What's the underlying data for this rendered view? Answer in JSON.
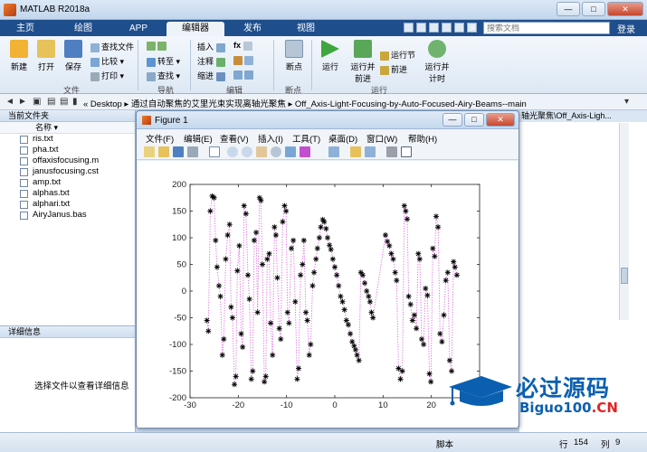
{
  "window": {
    "title": "MATLAB R2018a",
    "controls": [
      "—",
      "□",
      "✕"
    ]
  },
  "tabs": [
    "主页",
    "绘图",
    "APP",
    "编辑器",
    "发布",
    "视图"
  ],
  "active_tab": "编辑器",
  "search": {
    "placeholder": "搜索文档"
  },
  "login_label": "登录",
  "ribbon": {
    "file_group": {
      "label": "文件",
      "new": "新建",
      "open": "打开",
      "save": "保存",
      "find_files": "查找文件",
      "compare": "比较",
      "print": "打印"
    },
    "nav_group": {
      "label": "导航",
      "goto": "转至",
      "find": "查找"
    },
    "edit_group": {
      "label": "编辑",
      "insert": "插入",
      "comment": "注释",
      "indent": "缩进",
      "fx": "fx"
    },
    "break_group": {
      "label": "断点",
      "breakpoints": "断点"
    },
    "run_group": {
      "label": "运行",
      "run": "运行",
      "run_advance": "运行并前进",
      "run_section": "运行节",
      "advance": "前进",
      "run_time": "运行并计时"
    }
  },
  "address": {
    "path": "« Desktop ▸ 通过自动聚焦的艾里光束实现离轴光聚焦 ▸ Off_Axis-Light-Focusing-by-Auto-Focused-Airy-Beams--main"
  },
  "folder_panel": {
    "title": "当前文件夹",
    "column": "名称 ▾",
    "files": [
      "ris.txt",
      "pha.txt",
      "offaxisfocusing.m",
      "janusfocusing.cst",
      "amp.txt",
      "alphas.txt",
      "alphari.txt",
      "AiryJanus.bas"
    ]
  },
  "details_panel": {
    "title": "详细信息",
    "message": "选择文件以查看详细信息"
  },
  "background_panel": {
    "header": "轴光聚焦\\Off_Axis-Ligh..."
  },
  "status": {
    "mode": "脚本",
    "row_label": "行",
    "row": "154",
    "col_label": "列",
    "col": "9"
  },
  "figure": {
    "title": "Figure 1",
    "menu": [
      "文件(F)",
      "编辑(E)",
      "查看(V)",
      "插入(I)",
      "工具(T)",
      "桌面(D)",
      "窗口(W)",
      "帮助(H)"
    ],
    "controls": [
      "—",
      "□",
      "✕"
    ]
  },
  "chart_data": {
    "type": "scatter",
    "title": "",
    "xlabel": "",
    "ylabel": "",
    "xlim": [
      -30,
      30
    ],
    "ylim": [
      -200,
      200
    ],
    "xticks": [
      -30,
      -20,
      -10,
      0,
      10,
      20
    ],
    "yticks": [
      -200,
      -150,
      -100,
      -50,
      0,
      50,
      100,
      150,
      200
    ],
    "series": [
      {
        "marker": "*",
        "color": "#000000",
        "line_style": "dotted",
        "line_color": "#e060e0",
        "points": [
          [
            -26.5,
            -55
          ],
          [
            -26.2,
            -75
          ],
          [
            -25.8,
            150
          ],
          [
            -25.4,
            178
          ],
          [
            -25,
            175
          ],
          [
            -24.7,
            95
          ],
          [
            -24.4,
            45
          ],
          [
            -24,
            10
          ],
          [
            -23.7,
            -10
          ],
          [
            -23.3,
            -120
          ],
          [
            -23,
            -90
          ],
          [
            -22.6,
            60
          ],
          [
            -22.2,
            105
          ],
          [
            -21.8,
            125
          ],
          [
            -21.5,
            -30
          ],
          [
            -21.2,
            -50
          ],
          [
            -20.8,
            -175
          ],
          [
            -20.5,
            -160
          ],
          [
            -20.2,
            38
          ],
          [
            -19.8,
            85
          ],
          [
            -19.4,
            -80
          ],
          [
            -19.1,
            -105
          ],
          [
            -18.8,
            160
          ],
          [
            -18.4,
            145
          ],
          [
            -18,
            30
          ],
          [
            -17.7,
            -15
          ],
          [
            -17.3,
            -165
          ],
          [
            -17,
            -150
          ],
          [
            -16.7,
            95
          ],
          [
            -16.3,
            110
          ],
          [
            -16,
            -40
          ],
          [
            -15.6,
            175
          ],
          [
            -15.3,
            170
          ],
          [
            -15,
            50
          ],
          [
            -14.6,
            -170
          ],
          [
            -14.3,
            -160
          ],
          [
            -14,
            60
          ],
          [
            -13.6,
            70
          ],
          [
            -13.3,
            -60
          ],
          [
            -12.9,
            -120
          ],
          [
            -12.5,
            120
          ],
          [
            -12.2,
            105
          ],
          [
            -11.9,
            25
          ],
          [
            -11.5,
            -70
          ],
          [
            -11.2,
            -90
          ],
          [
            -10.8,
            130
          ],
          [
            -10.4,
            160
          ],
          [
            -10.1,
            150
          ],
          [
            -9.8,
            -40
          ],
          [
            -9.5,
            -60
          ],
          [
            -9,
            80
          ],
          [
            -8.6,
            95
          ],
          [
            -8.2,
            -20
          ],
          [
            -7.8,
            -165
          ],
          [
            -7.5,
            -145
          ],
          [
            -7.1,
            30
          ],
          [
            -6.7,
            50
          ],
          [
            -6.4,
            95
          ],
          [
            -6,
            -40
          ],
          [
            -5.7,
            -55
          ],
          [
            -5.3,
            -120
          ],
          [
            -5,
            -100
          ],
          [
            -4.6,
            10
          ],
          [
            -4.3,
            35
          ],
          [
            -3.9,
            60
          ],
          [
            -3.6,
            80
          ],
          [
            -3.2,
            100
          ],
          [
            -2.9,
            120
          ],
          [
            -2.5,
            134
          ],
          [
            -2.2,
            130
          ],
          [
            -1.8,
            117
          ],
          [
            -1.5,
            100
          ],
          [
            -1.1,
            86
          ],
          [
            -0.8,
            78
          ],
          [
            -0.4,
            60
          ],
          [
            0,
            45
          ],
          [
            0.4,
            30
          ],
          [
            0.8,
            10
          ],
          [
            1.2,
            -10
          ],
          [
            1.6,
            -20
          ],
          [
            2,
            -35
          ],
          [
            2.4,
            -55
          ],
          [
            2.8,
            -63
          ],
          [
            3.2,
            -80
          ],
          [
            3.6,
            -95
          ],
          [
            4,
            -103
          ],
          [
            4.3,
            -110
          ],
          [
            4.6,
            -120
          ],
          [
            5,
            -130
          ],
          [
            5.4,
            35
          ],
          [
            5.8,
            30
          ],
          [
            6.2,
            15
          ],
          [
            6.6,
            0
          ],
          [
            7,
            -10
          ],
          [
            7.3,
            -20
          ],
          [
            7.6,
            -40
          ],
          [
            7.9,
            -50
          ],
          [
            10.5,
            105
          ],
          [
            10.9,
            93
          ],
          [
            11.3,
            85
          ],
          [
            11.7,
            70
          ],
          [
            12.1,
            60
          ],
          [
            12.5,
            35
          ],
          [
            12.8,
            20
          ],
          [
            13.2,
            -145
          ],
          [
            13.6,
            -165
          ],
          [
            14,
            -150
          ],
          [
            14.4,
            160
          ],
          [
            14.7,
            150
          ],
          [
            15,
            135
          ],
          [
            15.3,
            -10
          ],
          [
            15.7,
            -25
          ],
          [
            16.1,
            -55
          ],
          [
            16.5,
            -45
          ],
          [
            16.9,
            -70
          ],
          [
            17.3,
            70
          ],
          [
            17.6,
            60
          ],
          [
            18,
            -90
          ],
          [
            18.4,
            -100
          ],
          [
            18.8,
            5
          ],
          [
            19.2,
            -8
          ],
          [
            19.6,
            -155
          ],
          [
            19.9,
            -170
          ],
          [
            20.3,
            80
          ],
          [
            20.7,
            65
          ],
          [
            21,
            140
          ],
          [
            21.4,
            120
          ],
          [
            21.8,
            -80
          ],
          [
            22.2,
            -95
          ],
          [
            22.6,
            -45
          ],
          [
            23,
            20
          ],
          [
            23.4,
            35
          ],
          [
            23.8,
            -130
          ],
          [
            24.2,
            -150
          ],
          [
            24.6,
            55
          ],
          [
            24.9,
            45
          ],
          [
            25.3,
            30
          ]
        ]
      }
    ]
  }
}
